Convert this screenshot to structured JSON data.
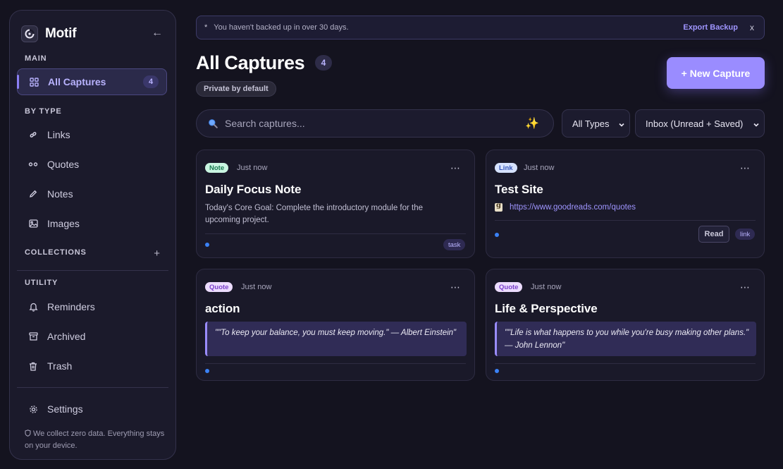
{
  "app": {
    "name": "Motif",
    "collapse_icon": "←"
  },
  "sidebar": {
    "main_label": "MAIN",
    "all_captures": {
      "label": "All Captures",
      "count": "4"
    },
    "by_type_label": "BY TYPE",
    "types": [
      {
        "label": "Links",
        "icon": "link-icon"
      },
      {
        "label": "Quotes",
        "icon": "quote-icon"
      },
      {
        "label": "Notes",
        "icon": "pencil-icon"
      },
      {
        "label": "Images",
        "icon": "image-icon"
      }
    ],
    "collections_label": "COLLECTIONS",
    "collections_add": "+",
    "utility_label": "UTILITY",
    "utility": [
      {
        "label": "Reminders",
        "icon": "bell-icon"
      },
      {
        "label": "Archived",
        "icon": "archive-icon"
      },
      {
        "label": "Trash",
        "icon": "trash-icon"
      }
    ],
    "settings": {
      "label": "Settings",
      "icon": "gear-icon"
    },
    "footer_note": "We collect zero data. Everything stays on your device."
  },
  "banner": {
    "icon": "*",
    "message": "You haven't backed up in over 30 days.",
    "action": "Export Backup",
    "close": "x"
  },
  "header": {
    "title": "All Captures",
    "count": "4",
    "privacy": "Private by default",
    "new_button": "+ New Capture"
  },
  "filters": {
    "search_placeholder": "Search captures...",
    "sparkle": "✨",
    "type_select": "All Types",
    "view_select": "Inbox (Unread + Saved)"
  },
  "cards": [
    {
      "type": "Note",
      "time": "Just now",
      "menu": "⋯",
      "title": "Daily Focus Note",
      "body": "Today's Core Goal: Complete the introductory module for the upcoming project.",
      "tag": "task"
    },
    {
      "type": "Link",
      "time": "Just now",
      "menu": "⋯",
      "title": "Test Site",
      "url": "https://www.goodreads.com/quotes",
      "action": "Read",
      "tag": "link"
    },
    {
      "type": "Quote",
      "time": "Just now",
      "menu": "⋯",
      "title": "action",
      "quote": "\"\"To keep your balance, you must keep moving.\" — Albert Einstein\""
    },
    {
      "type": "Quote",
      "time": "Just now",
      "menu": "⋯",
      "title": "Life & Perspective",
      "quote": "\"\"Life is what happens to you while you're busy making other plans.\" — John Lennon\""
    }
  ],
  "colors": {
    "accent": "#9a8cff",
    "background": "#14131f",
    "panel": "#1b1a2b",
    "unread_dot": "#3b82f6"
  }
}
